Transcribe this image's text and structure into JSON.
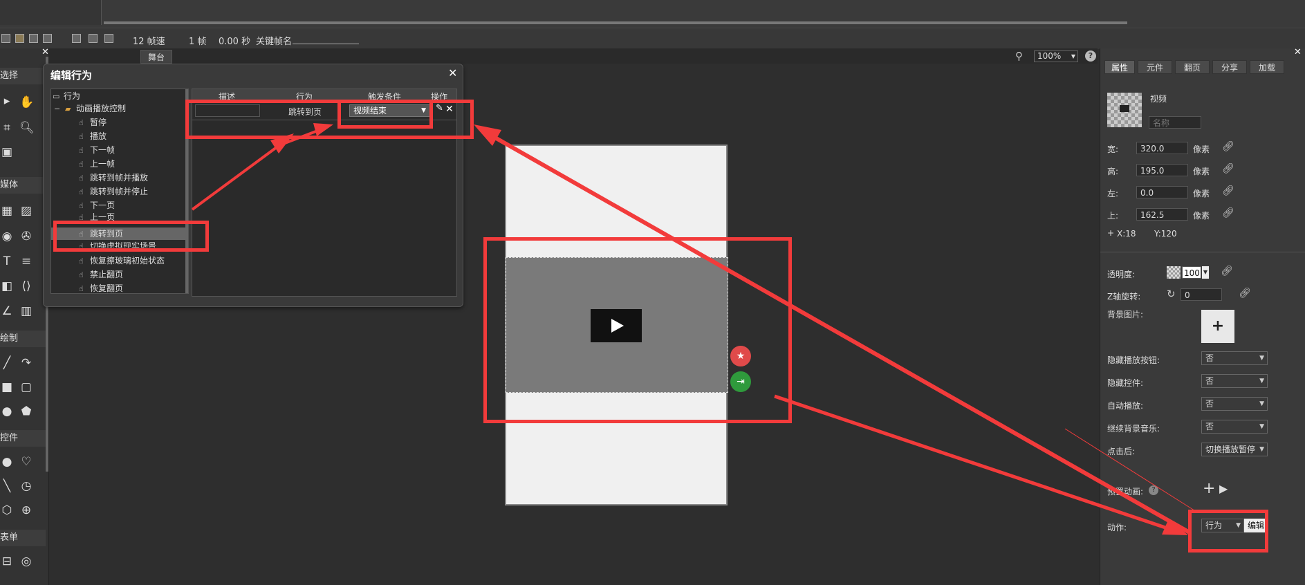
{
  "toolbar": {
    "fps": "12 帧速",
    "frames": "1 帧",
    "time": "0.00 秒",
    "keyframe_label": "关键帧名"
  },
  "palette": {
    "sections": [
      "选择",
      "媒体",
      "绘制",
      "控件",
      "表单"
    ]
  },
  "stage": {
    "tab": "舞台",
    "zoom": "100%",
    "help": "?"
  },
  "right_panel": {
    "tabs": [
      "属性",
      "元件",
      "翻页",
      "分享",
      "加载"
    ],
    "element_type": "视频",
    "name_placeholder": "名称",
    "width_label": "宽:",
    "width_value": "320.0",
    "height_label": "高:",
    "height_value": "195.0",
    "left_label": "左:",
    "left_value": "0.0",
    "top_label": "上:",
    "top_value": "162.5",
    "unit": "像素",
    "coord_x": "X:18",
    "coord_y": "Y:120",
    "opacity_label": "透明度:",
    "opacity_value": "100",
    "zrot_label": "Z轴旋转:",
    "zrot_value": "0",
    "bgimg_label": "背景图片:",
    "hide_play_label": "隐藏播放按钮:",
    "hide_play_value": "否",
    "hide_controls_label": "隐藏控件:",
    "hide_controls_value": "否",
    "autoplay_label": "自动播放:",
    "autoplay_value": "否",
    "continue_bgm_label": "继续背景音乐:",
    "continue_bgm_value": "否",
    "after_click_label": "点击后:",
    "after_click_value": "切换播放暂停",
    "preset_anim_label": "预置动画:",
    "action_label": "动作:",
    "action_value": "行为",
    "edit_button": "编辑"
  },
  "dialog": {
    "title": "编辑行为",
    "tree_root": "行为",
    "tree_group": "动画播放控制",
    "tree_items": [
      "暂停",
      "播放",
      "下一帧",
      "上一帧",
      "跳转到帧并播放",
      "跳转到帧并停止",
      "下一页",
      "上一页",
      "跳转到页",
      "切换虚拟现实场景",
      "恢复擦玻璃初始状态",
      "禁止翻页",
      "恢复翻页"
    ],
    "columns": [
      "描述",
      "行为",
      "触发条件",
      "操作"
    ],
    "row": {
      "description": "",
      "behavior": "跳转到页",
      "trigger": "视频结束"
    }
  },
  "colors": {
    "annotation": "#f23b3b",
    "background": "#2e2e2e",
    "panel": "#3a3a3a"
  }
}
